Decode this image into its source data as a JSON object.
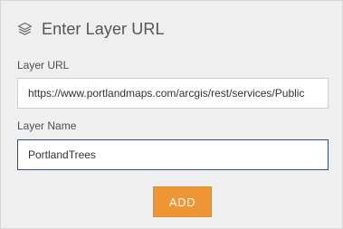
{
  "header": {
    "title": "Enter Layer URL",
    "icon": "layers-icon"
  },
  "layer_url": {
    "label": "Layer URL",
    "value": "https://www.portlandmaps.com/arcgis/rest/services/Public"
  },
  "layer_name": {
    "label": "Layer Name",
    "value": "PortlandTrees"
  },
  "actions": {
    "add_label": "ADD"
  },
  "colors": {
    "accent": "#ee9535",
    "panel_bg": "#efefef",
    "focus_border": "#2f4f7f"
  }
}
